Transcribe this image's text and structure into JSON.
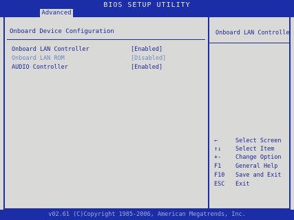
{
  "window": {
    "title": "BIOS SETUP UTILITY"
  },
  "tabs": [
    {
      "label": "Advanced",
      "selected": true
    }
  ],
  "page": {
    "heading": "Onboard Device Configuration"
  },
  "settings": [
    {
      "label": "Onboard LAN Controller",
      "value": "[Enabled]",
      "state": "active"
    },
    {
      "label": "Onboard LAN ROM",
      "value": "[Disabled]",
      "state": "inactive"
    },
    {
      "label": "AUDIO Controller",
      "value": "[Enabled]",
      "state": "active"
    }
  ],
  "help": {
    "text": "Onboard LAN Controlle"
  },
  "keys": [
    {
      "key": "←",
      "desc": "Select Screen",
      "icon": "arrow-left-icon"
    },
    {
      "key": "↑↓",
      "desc": "Select Item",
      "icon": "arrow-up-down-icon"
    },
    {
      "key": "+-",
      "desc": "Change Option",
      "icon": "plus-minus-icon"
    },
    {
      "key": "F1",
      "desc": "General Help"
    },
    {
      "key": "F10",
      "desc": "Save and Exit"
    },
    {
      "key": "ESC",
      "desc": "Exit"
    }
  ],
  "footer": {
    "text": "v02.61 (C)Copyright 1985-2006, American Megatrends, Inc."
  },
  "colors": {
    "accent": "#1c2da8",
    "background": "#d9dad7",
    "text": "#1b2496",
    "disabled_text": "#6d87c6"
  }
}
